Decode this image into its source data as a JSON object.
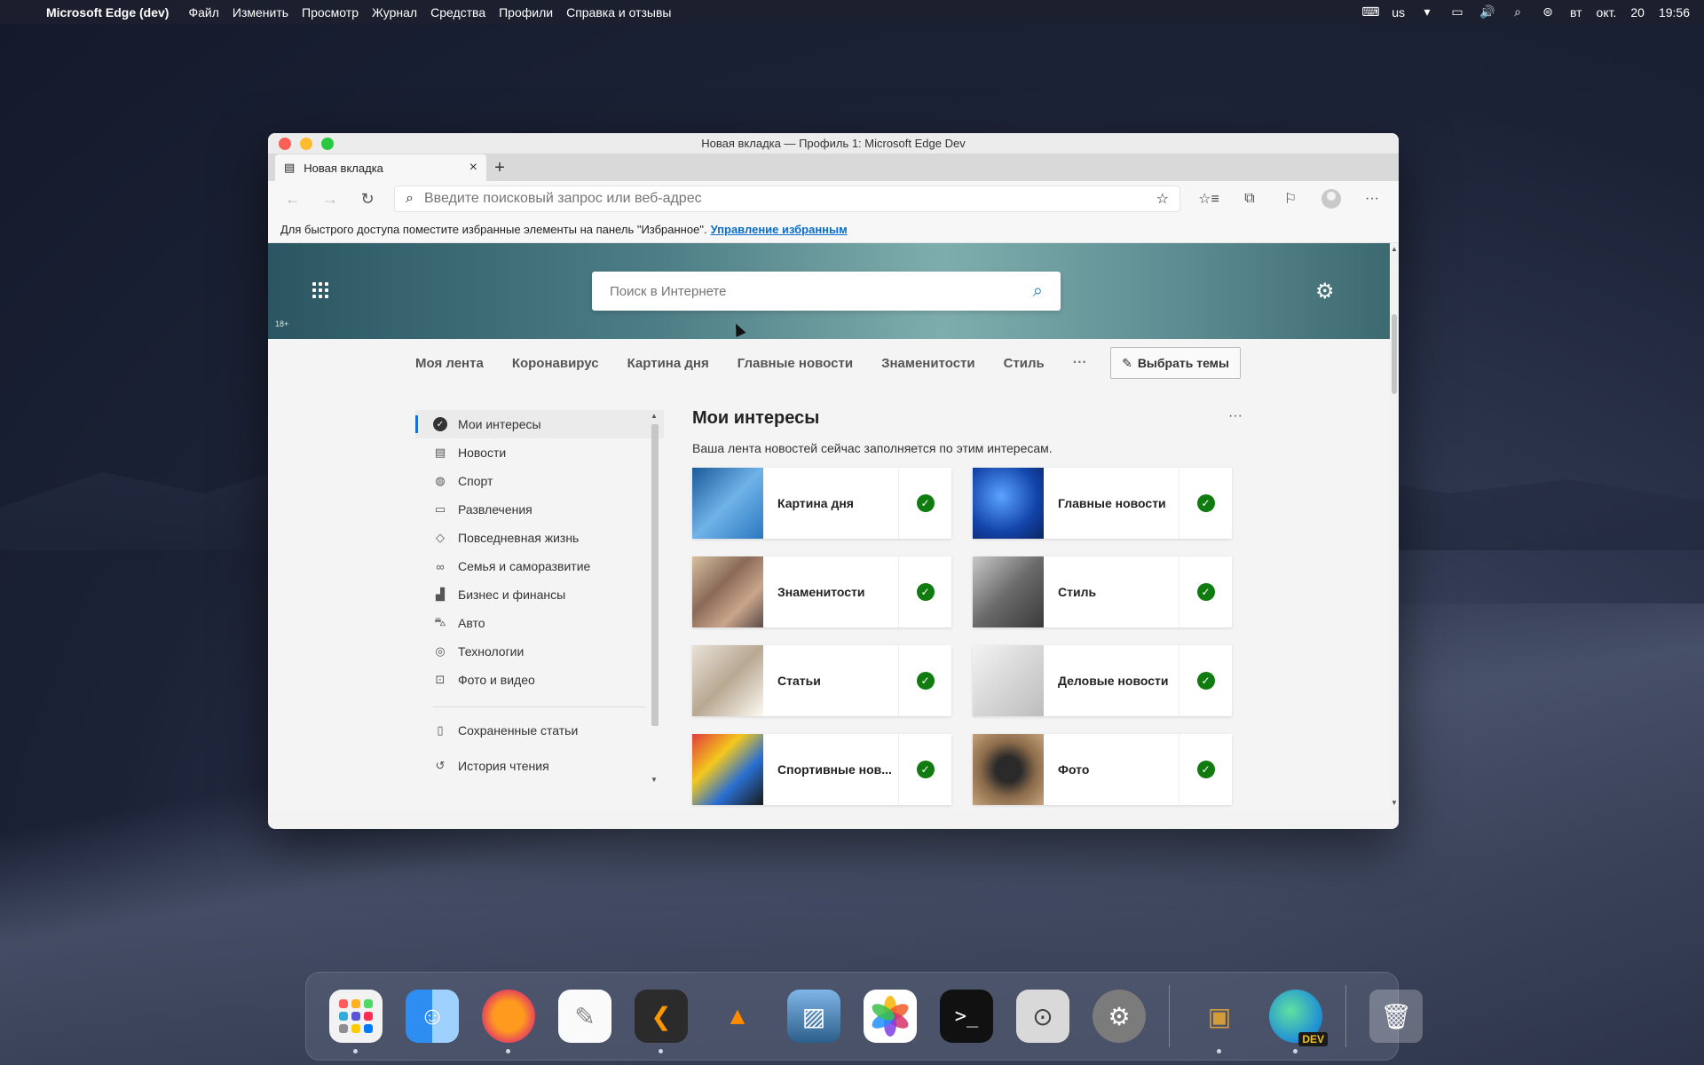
{
  "menubar": {
    "app_name": "Microsoft Edge (dev)",
    "items": [
      "Файл",
      "Изменить",
      "Просмотр",
      "Журнал",
      "Средства",
      "Профили",
      "Справка и отзывы"
    ],
    "input_source": "us",
    "day": "вт",
    "month": "окт.",
    "date": "20",
    "time": "19:56"
  },
  "window": {
    "title": "Новая вкладка — Профиль 1: Microsoft Edge Dev",
    "tab_title": "Новая вкладка",
    "address_placeholder": "Введите поисковый запрос или веб-адрес",
    "favorites_hint": "Для быстрого доступа поместите избранные элементы на панель \"Избранное\".",
    "favorites_link": "Управление избранным"
  },
  "newtab": {
    "search_placeholder": "Поиск в Интернете",
    "age_badge": "18+",
    "topics": [
      "Моя лента",
      "Коронавирус",
      "Картина дня",
      "Главные новости",
      "Знаменитости",
      "Стиль"
    ],
    "topics_more": "···",
    "choose_topics_label": "Выбрать темы"
  },
  "sidebar": {
    "items": [
      {
        "label": "Мои интересы",
        "icon": "check-circle-icon"
      },
      {
        "label": "Новости",
        "icon": "newspaper-icon"
      },
      {
        "label": "Спорт",
        "icon": "ball-icon"
      },
      {
        "label": "Развлечения",
        "icon": "film-icon"
      },
      {
        "label": "Повседневная жизнь",
        "icon": "diamond-icon"
      },
      {
        "label": "Семья и саморазвитие",
        "icon": "glasses-icon"
      },
      {
        "label": "Бизнес и финансы",
        "icon": "chart-icon"
      },
      {
        "label": "Авто",
        "icon": "car-icon"
      },
      {
        "label": "Технологии",
        "icon": "tech-icon"
      },
      {
        "label": "Фото и видео",
        "icon": "photo-icon"
      }
    ],
    "saved_label": "Сохраненные статьи",
    "history_label": "История чтения"
  },
  "content": {
    "title": "Мои интересы",
    "more": "···",
    "subtitle": "Ваша лента новостей сейчас заполняется по этим интересам.",
    "cards": [
      {
        "label": "Картина дня"
      },
      {
        "label": "Главные новости"
      },
      {
        "label": "Знаменитости"
      },
      {
        "label": "Стиль"
      },
      {
        "label": "Статьи"
      },
      {
        "label": "Деловые новости"
      },
      {
        "label": "Спортивные нов..."
      },
      {
        "label": "Фото"
      }
    ]
  },
  "dock": {
    "edge_badge": "DEV",
    "terminal_glyph": ">_"
  },
  "colors": {
    "accent_blue": "#1a6fd1",
    "check_green": "#107c10",
    "link_blue": "#0a6ccc"
  }
}
